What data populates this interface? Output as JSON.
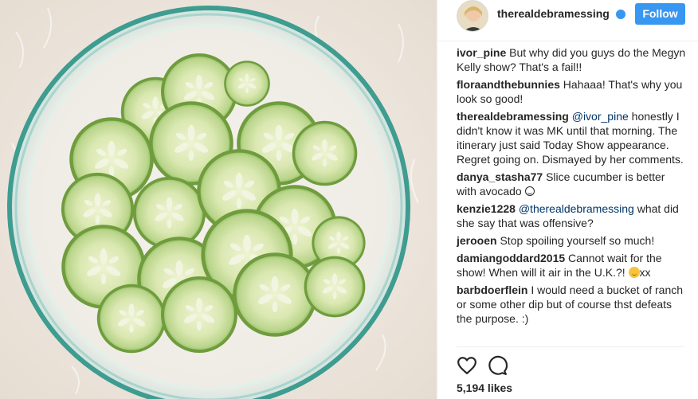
{
  "post": {
    "image_alt": "Glass bowl filled with sliced cucumbers on a white fluffy rug",
    "colors": {
      "follow_blue": "#3897f0",
      "mention_blue": "#003569",
      "text": "#262626"
    }
  },
  "header": {
    "username": "therealdebramessing",
    "follow_label": "Follow",
    "verified_icon": "verified-badge-icon"
  },
  "comments": [
    {
      "user": "ivor_pine",
      "text": " But why did you guys do the Megyn Kelly show? That's a fail!!"
    },
    {
      "user": "floraandthebunnies",
      "text": " Hahaaa! That's why you look so good!"
    },
    {
      "user": "therealdebramessing",
      "mention": "@ivor_pine",
      "text": " honestly I didn't know it was MK until that morning. The itinerary just said Today Show appearance. Regret going on. Dismayed by her comments."
    },
    {
      "user": "danya_stasha77",
      "text": " Slice cucumber is better with avocado "
    },
    {
      "user": "kenzie1228",
      "mention": "@therealdebramessing",
      "text": " what did she say that was offensive?"
    },
    {
      "user": "jerooen",
      "text": " Stop spoiling yourself so much!"
    },
    {
      "user": "damiangoddard2015",
      "text": " Cannot wait for the show! When will it air in the U.K.?! ",
      "tail": "xx"
    },
    {
      "user": "barbdoerflein",
      "text": " I would need a bucket of ranch or some other dip but of course thst defeats the purpose. :)"
    }
  ],
  "actions": {
    "like_icon": "heart-icon",
    "comment_icon": "speech-bubble-icon"
  },
  "likes": {
    "count_label": "5,194 likes"
  }
}
